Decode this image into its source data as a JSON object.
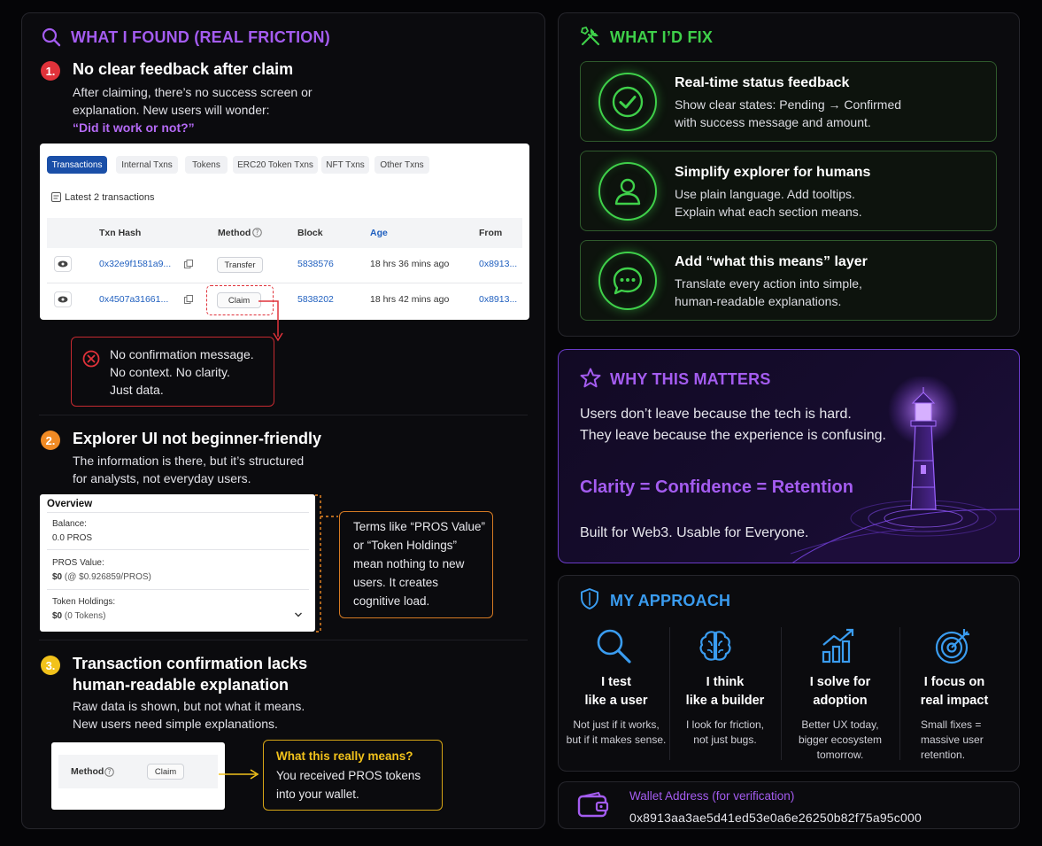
{
  "found": {
    "title": "WHAT I FOUND (REAL FRICTION)",
    "item1": {
      "num": "1.",
      "title": "No clear feedback after claim",
      "desc1": "After claiming, there’s no success screen or",
      "desc2": "explanation. New users will wonder:",
      "quote": "“Did it work or not?”"
    },
    "explorer": {
      "tabs": [
        "Transactions",
        "Internal Txns",
        "Tokens",
        "ERC20 Token Txns",
        "NFT Txns",
        "Other Txns"
      ],
      "latest": "Latest 2 transactions",
      "headers": [
        "Txn Hash",
        "Method",
        "Block",
        "Age",
        "From"
      ],
      "rows": [
        {
          "hash": "0x32e9f1581a9...",
          "method": "Transfer",
          "block": "5838576",
          "age": "18 hrs 36 mins ago",
          "from": "0x8913..."
        },
        {
          "hash": "0x4507a31661...",
          "method": "Claim",
          "block": "5838202",
          "age": "18 hrs 42 mins ago",
          "from": "0x8913..."
        }
      ]
    },
    "callout1": {
      "line1": "No confirmation message.",
      "line2": "No context. No clarity.",
      "line3": "Just data."
    },
    "item2": {
      "num": "2.",
      "title": "Explorer UI not beginner-friendly",
      "desc1": "The information is there, but it’s structured",
      "desc2": "for analysts, not everyday users."
    },
    "overview": {
      "title": "Overview",
      "balance_label": "Balance:",
      "balance_value": "0.0 PROS",
      "pros_label": "PROS Value:",
      "pros_value": "$0",
      "pros_note": "(@ $0.926859/PROS)",
      "holdings_label": "Token Holdings:",
      "holdings_value": "$0",
      "holdings_note": "(0 Tokens)"
    },
    "callout2": {
      "line1": "Terms like “PROS Value”",
      "line2": "or “Token Holdings”",
      "line3": "mean nothing to new",
      "line4": "users. It creates",
      "line5": "cognitive load."
    },
    "item3": {
      "num": "3.",
      "title1": "Transaction confirmation lacks",
      "title2": "human-readable explanation",
      "desc1": "Raw data is shown, but not what it means.",
      "desc2": "New users need simple explanations."
    },
    "method_box": {
      "label": "Method",
      "value": "Claim"
    },
    "callout3": {
      "title": "What this really means?",
      "line1": "You received PROS tokens",
      "line2": "into your wallet."
    }
  },
  "fix": {
    "title": "WHAT I’D FIX",
    "items": [
      {
        "title": "Real-time status feedback",
        "line1": "Show clear states: Pending → Confirmed",
        "line2": "with success message and amount.",
        "icon": "check-circle-icon"
      },
      {
        "title": "Simplify explorer for humans",
        "line1": "Use plain language. Add tooltips.",
        "line2": "Explain what each section means.",
        "icon": "user-icon"
      },
      {
        "title": "Add “what this means” layer",
        "line1": "Translate every action into simple,",
        "line2": "human-readable explanations.",
        "icon": "chat-bubble-icon"
      }
    ]
  },
  "why": {
    "title": "WHY THIS MATTERS",
    "line1": "Users don’t leave because the tech is hard.",
    "line2": "They leave because the experience is confusing.",
    "equation": "Clarity = Confidence = Retention",
    "tagline": "Built for Web3. Usable for Everyone."
  },
  "approach": {
    "title": "MY APPROACH",
    "items": [
      {
        "t1": "I test",
        "t2": "like a user",
        "s1": "Not just if it works,",
        "s2": "but if it makes sense.",
        "s3": ""
      },
      {
        "t1": "I think",
        "t2": "like a builder",
        "s1": "I look for friction,",
        "s2": "not just bugs.",
        "s3": ""
      },
      {
        "t1": "I solve for",
        "t2": "adoption",
        "s1": "Better UX today,",
        "s2": "bigger ecosystem",
        "s3": "tomorrow."
      },
      {
        "t1": "I focus on",
        "t2": "real impact",
        "s1": "Small fixes =",
        "s2": "massive user",
        "s3": "retention."
      }
    ]
  },
  "wallet": {
    "label": "Wallet Address (for verification)",
    "address": "0x8913aa3ae5d41ed53e0a6e26250b82f75a95c000"
  },
  "colors": {
    "purple": "#a45cf0",
    "green": "#3fd04a",
    "blue": "#3a9cf0",
    "red": "#e0323a",
    "orange": "#f08a24",
    "yellow": "#f2c21b"
  }
}
